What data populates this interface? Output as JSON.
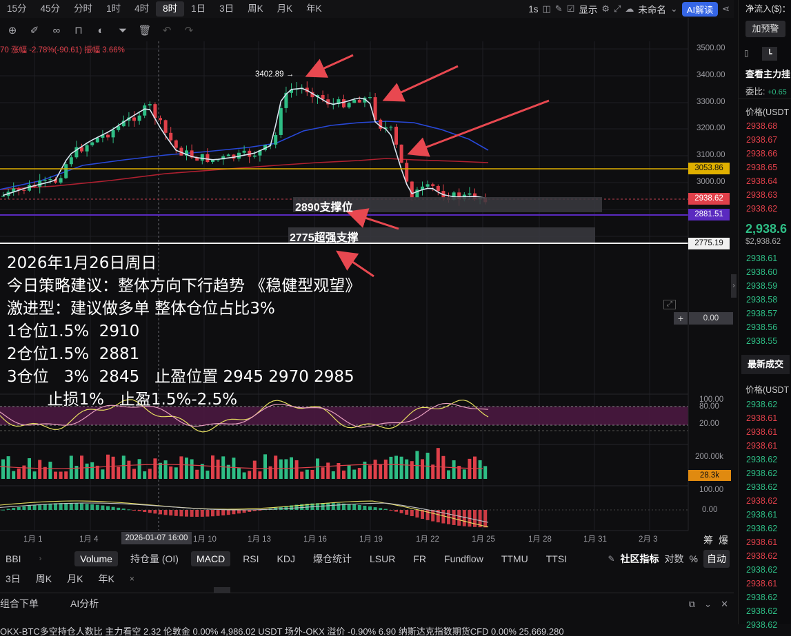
{
  "timeframes": [
    "15分",
    "45分",
    "分时",
    "1时",
    "4时",
    "8时",
    "1日",
    "3日",
    "周K",
    "月K",
    "年K"
  ],
  "active_timeframe": "8时",
  "toolbar_right": {
    "interval": "1s",
    "display_label": "显示",
    "unnamed_label": "未命名",
    "ai_label": "AI解读"
  },
  "info_line": {
    "prefix": "70",
    "change_text": "涨幅 -2.78%(-90.61)",
    "amplitude_text": "振幅 3.66%"
  },
  "y_axis_ticks": [
    "3500.00",
    "3400.00",
    "3300.00",
    "3200.00",
    "3100.00",
    "3000.00"
  ],
  "price_tags": {
    "resistance": "3053.86",
    "last": "2938.62",
    "support1": "2881.51",
    "support2": "2775.19"
  },
  "peak_label": "3402.89 →",
  "support_labels": {
    "s1": "2890支撑位",
    "s2": "2775超强支撑"
  },
  "strategy_lines": [
    "2026年1月26日周日",
    "今日策略建议：整体方向下行趋势 《稳健型观望》",
    "激进型：建议做多单 整体仓位占比3%",
    "1仓位1.5%  2910",
    "2仓位1.5%  2881",
    "3仓位   3%  2845   止盈位置 2945 2970 2985",
    "        止损1%   止盈1.5%-2.5%"
  ],
  "panel_zero_label": "0.00",
  "kdj_ticks": [
    "100.00",
    "80.00",
    "20.00"
  ],
  "volume_ticks": {
    "top": "200.00k",
    "current": "28.3k"
  },
  "macd_ticks": [
    "100.00",
    "0.00"
  ],
  "x_axis_ticks": [
    "1月 1",
    "1月 4",
    "1月 10",
    "1月 13",
    "1月 16",
    "1月 19",
    "1月 22",
    "1月 25",
    "1月 28",
    "1月 31",
    "2月 3"
  ],
  "crosshair_time": "2026-01-07 16:00",
  "x_axis_right": [
    "筹",
    "爆"
  ],
  "indicator_tabs": [
    "BBI",
    "Volume",
    "持仓量 (OI)",
    "MACD",
    "RSI",
    "KDJ",
    "爆仓统计",
    "LSUR",
    "FR",
    "Fundflow",
    "TTMU",
    "TTSI"
  ],
  "indicator_tabs_active": [
    "Volume",
    "MACD"
  ],
  "indicator_right": {
    "community": "社区指标",
    "log": "对数",
    "percent": "%",
    "auto": "自动"
  },
  "row2_items": [
    "3日",
    "周K",
    "月K",
    "年K",
    "×"
  ],
  "bottom_tabs": [
    "组合下单",
    "AI分析"
  ],
  "ticker_text": "OKX-BTC多空持仓人数比  主力看空  2.32     伦敦金  0.00%  4,986.02     USDT 场外-OKX  溢价 -0.90%  6.90     纳斯达克指数期货CFD  0.00%  25,669.280",
  "right_panel": {
    "net_inflow": "净流入($)：",
    "alert_button": "加预警",
    "main_force": "查看主力挂",
    "ratio_label": "委比:",
    "ratio_value": "+0.65",
    "price_header": "价格(USDT",
    "asks": [
      "2938.68",
      "2938.67",
      "2938.66",
      "2938.65",
      "2938.64",
      "2938.63",
      "2938.62"
    ],
    "last_price": "2,938.6",
    "last_price_usd": "$2,938.62",
    "bids": [
      "2938.61",
      "2938.60",
      "2938.59",
      "2938.58",
      "2938.57",
      "2938.56",
      "2938.55"
    ],
    "trades_tab": "最新成交",
    "trades_header": "价格(USDT",
    "trades": [
      "2938.62",
      "2938.61",
      "2938.61",
      "2938.61",
      "2938.62",
      "2938.62",
      "2938.62",
      "2938.62",
      "2938.61",
      "2938.62",
      "2938.61",
      "2938.62",
      "2938.62",
      "2938.61",
      "2938.62",
      "2938.62",
      "2938.62"
    ],
    "trades_colors": [
      "g",
      "r",
      "r",
      "r",
      "g",
      "g",
      "g",
      "r",
      "g",
      "g",
      "r",
      "r",
      "g",
      "r",
      "g",
      "g",
      "g"
    ]
  },
  "colors": {
    "up": "#2ebd85",
    "down": "#e0404a",
    "ma_fast": "#d8e4ef",
    "ma_mid": "#2848d8",
    "ma_slow": "#b02030",
    "resistance": "#e0b000",
    "support": "#5a2ac0",
    "arrow": "#e84850"
  }
}
